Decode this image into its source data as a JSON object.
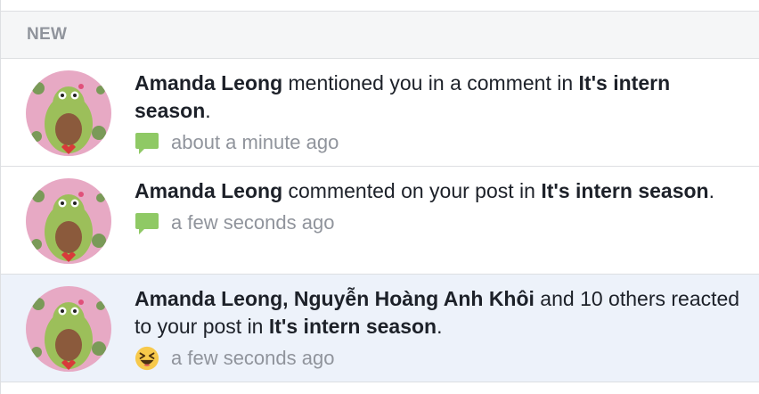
{
  "section": {
    "title": "NEW"
  },
  "notifications": [
    {
      "actor": "Amanda Leong",
      "action": " mentioned you in a comment in ",
      "target": "It's intern season",
      "suffix": ".",
      "icon": "comment-icon",
      "time": "about a minute ago",
      "unread": false
    },
    {
      "actor": "Amanda Leong",
      "action": " commented on your post in ",
      "target": "It's intern season",
      "suffix": ".",
      "icon": "comment-icon",
      "time": "a few seconds ago",
      "unread": false
    },
    {
      "actor": "Amanda Leong, Nguyễn Hoàng Anh Khôi",
      "action": " and 10 others reacted to your post in ",
      "target": "It's intern season",
      "suffix": ".",
      "icon": "haha-reaction-icon",
      "time": "a few seconds ago",
      "unread": true
    }
  ],
  "colors": {
    "unread_background": "#edf2fa",
    "comment_icon": "#8fc965",
    "meta_text": "#90949c",
    "body_text": "#1d2129"
  }
}
